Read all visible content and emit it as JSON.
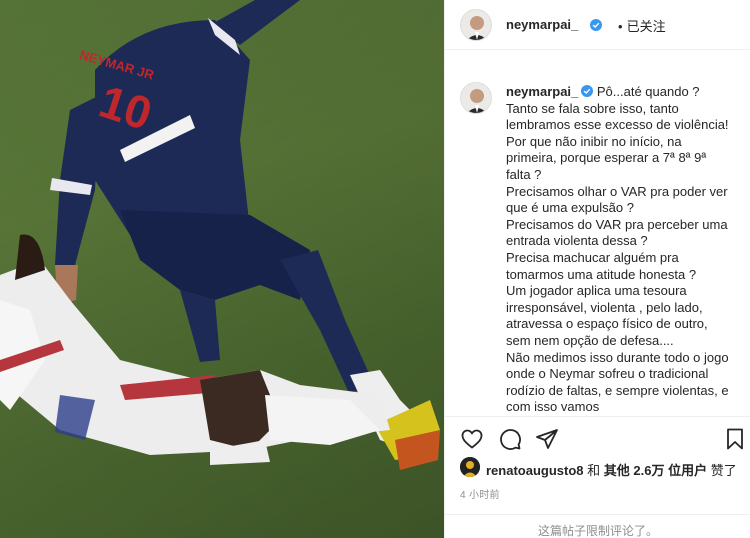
{
  "post": {
    "media": {
      "jersey_number": "10",
      "jersey_name": "NEYMAR JR"
    },
    "header": {
      "username": "neymarpai_",
      "separator": "•",
      "follow_state": "已关注",
      "more": "···"
    },
    "caption": {
      "username": "neymarpai_",
      "text": "Pô...até quando ?\nTanto se fala sobre isso, tanto lembramos esse excesso de violência!\nPor que não inibir no início, na primeira, porque esperar a 7ª 8ª 9ª falta ?\nPrecisamos olhar o VAR pra poder ver que é uma expulsão ?\nPrecisamos do VAR pra perceber uma entrada violenta dessa ?\nPrecisa machucar alguém pra tomarmos uma atitude honesta ?\nUm jogador aplica uma tesoura irresponsável, violenta , pelo lado, atravessa o espaço físico de outro, sem nem opção de defesa....\nNão medimos isso durante todo o jogo onde o Neymar sofreu o tradicional rodízio de faltas, e sempre violentas, e com isso vamos"
    },
    "actions": {
      "like": "heart-icon",
      "comment": "comment-icon",
      "share": "share-icon",
      "save": "bookmark-icon"
    },
    "likes": {
      "first_user": "renatoaugusto8",
      "connector": "和",
      "others_label": "其他",
      "others_count": "2.6万",
      "tail": "位用户",
      "liked": "赞了"
    },
    "timestamp": "4 小时前",
    "comments_disabled": "这篇帖子限制评论了。"
  }
}
